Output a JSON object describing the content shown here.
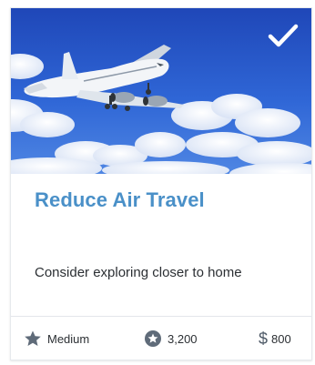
{
  "card": {
    "title": "Reduce Air Travel",
    "description": "Consider exploring closer to home",
    "selected": true,
    "image_subject": "airplane in blue sky with clouds",
    "accent_color": "#4a90c8",
    "stats": {
      "difficulty": "Medium",
      "points": "3,200",
      "cost_symbol": "$",
      "cost": "800"
    },
    "icons": {
      "selected": "checkmark-icon",
      "difficulty": "star-icon",
      "points": "badge-star-icon",
      "cost": "dollar-icon"
    }
  }
}
